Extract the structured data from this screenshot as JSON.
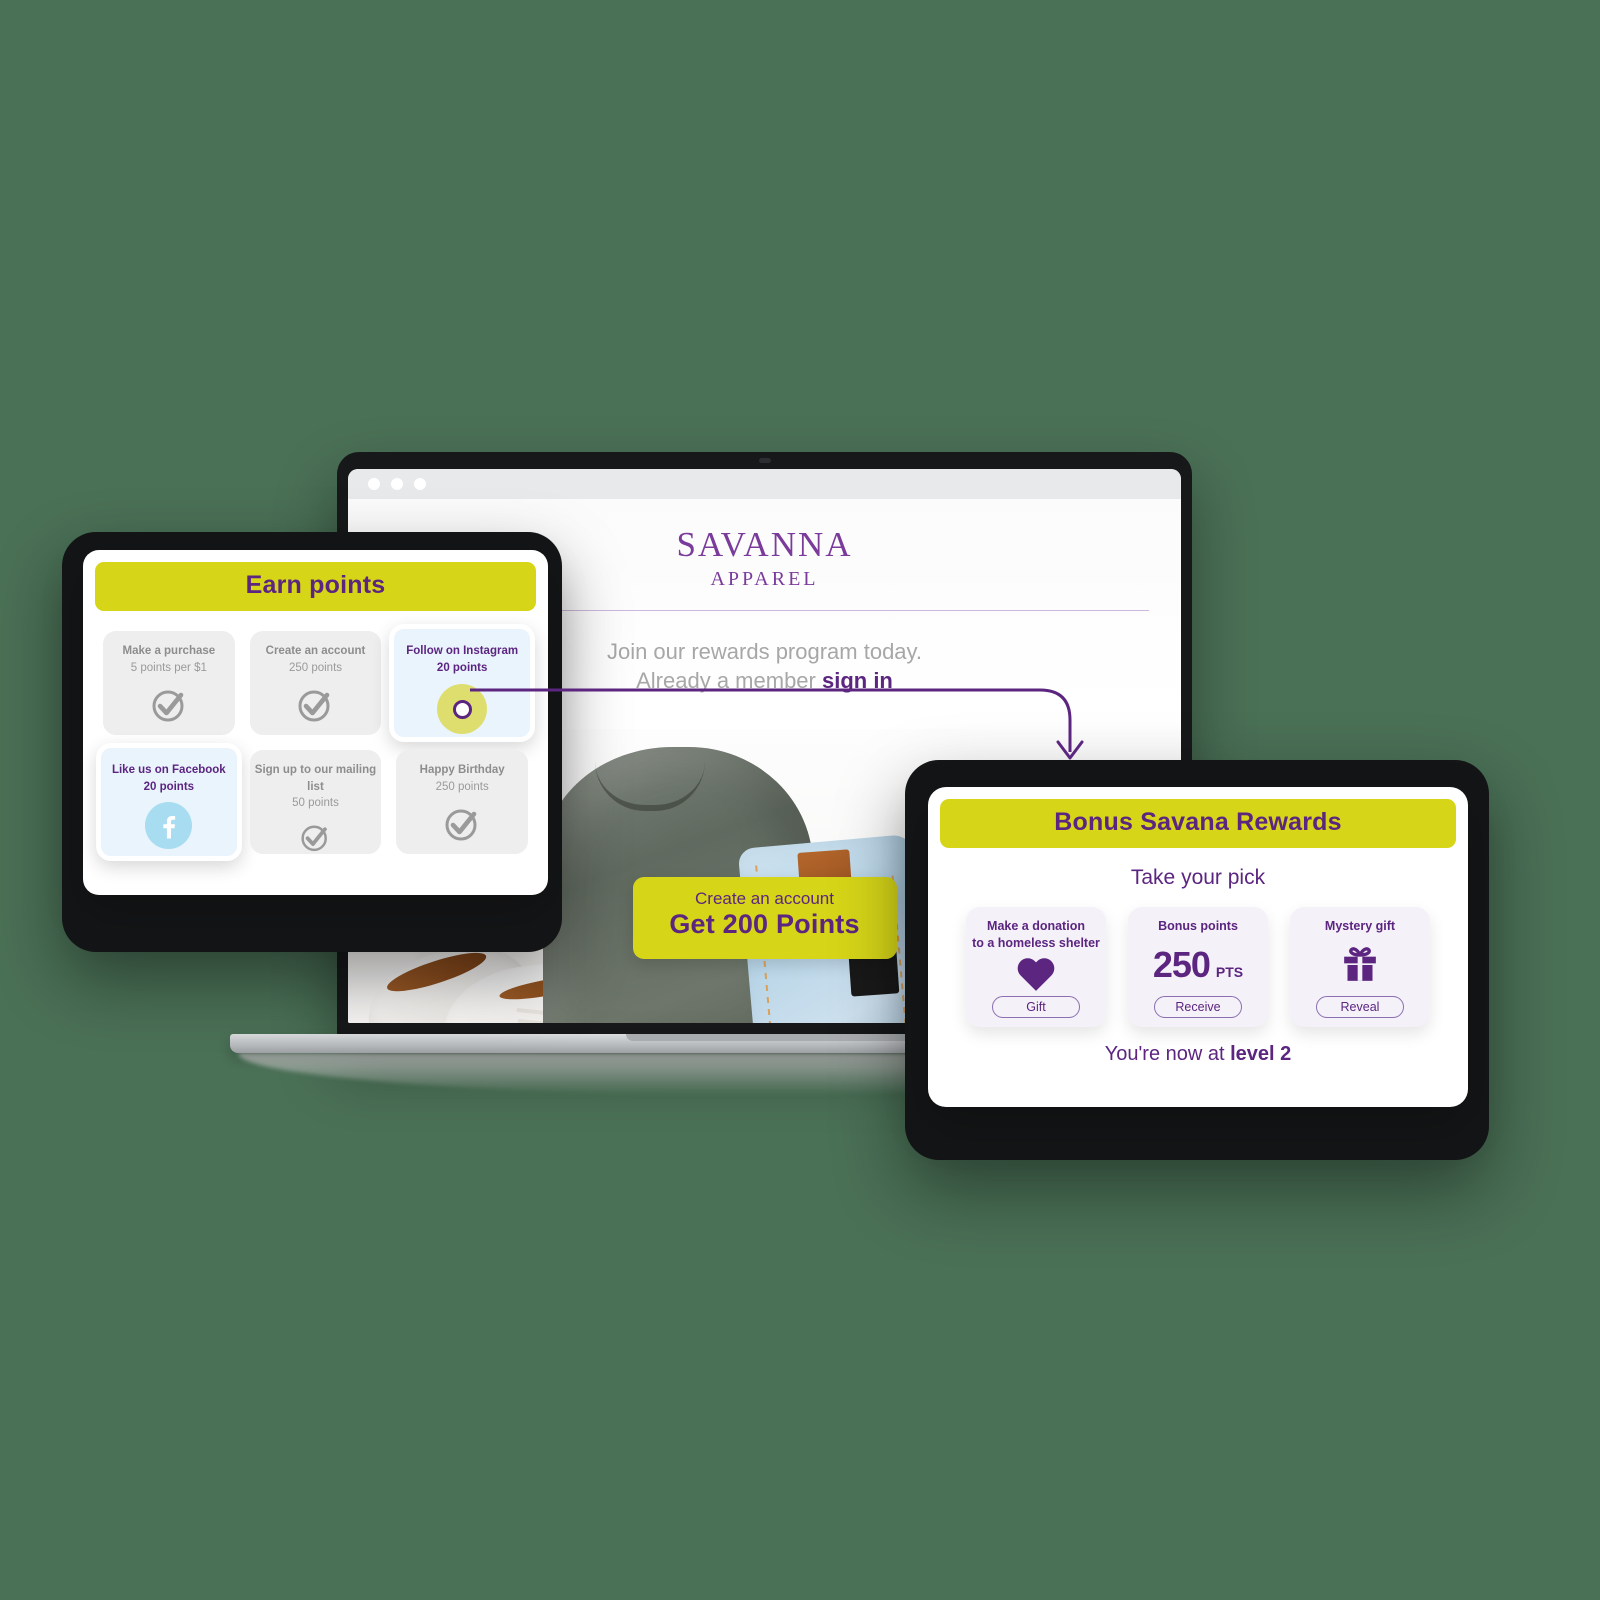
{
  "browser": {
    "dots": [
      "dot-1",
      "dot-2",
      "dot-3"
    ]
  },
  "site": {
    "brand_name": "SAVANNA",
    "brand_sub": "APPAREL",
    "tagline_line1": "Join our rewards program today.",
    "tagline_line2_prefix": "Already a member ",
    "tagline_signin": "sign in",
    "cta_top": "Create an account",
    "cta_main": "Get 200 Points"
  },
  "earn_panel": {
    "title": "Earn points",
    "tiles": [
      {
        "title": "Make a purchase",
        "points": "5 points per $1",
        "icon": "check-circle-icon",
        "state": "inactive"
      },
      {
        "title": "Create an account",
        "points": "250 points",
        "icon": "check-circle-icon",
        "state": "inactive"
      },
      {
        "title": "Follow on Instagram",
        "points": "20 points",
        "icon": "instagram-node-icon",
        "state": "active"
      },
      {
        "title": "Like us on Facebook",
        "points": "20 points",
        "icon": "facebook-icon",
        "state": "active"
      },
      {
        "title": "Sign up to our mailing list",
        "points": "50 points",
        "icon": "check-circle-icon",
        "state": "inactive"
      },
      {
        "title": "Happy Birthday",
        "points": "250 points",
        "icon": "check-circle-icon",
        "state": "inactive"
      }
    ]
  },
  "bonus_panel": {
    "title": "Bonus Savana Rewards",
    "subtitle": "Take your pick",
    "tiles": [
      {
        "title": "Make a donation\nto a homeless shelter",
        "title_line1": "Make a donation",
        "title_line2": "to a homeless shelter",
        "icon": "heart-icon",
        "value": "",
        "unit": "",
        "button": "Gift"
      },
      {
        "title_line1": "Bonus points",
        "title_line2": "",
        "icon": "points-value",
        "value": "250",
        "unit": "PTS",
        "button": "Receive"
      },
      {
        "title_line1": "Mystery gift",
        "title_line2": "",
        "icon": "gift-icon",
        "value": "",
        "unit": "",
        "button": "Reveal"
      }
    ],
    "footer_prefix": "You're now at ",
    "footer_level": "level 2"
  },
  "colors": {
    "accent_yellow": "#d6d518",
    "brand_purple": "#5b2580",
    "logo_purple": "#7a3b9b",
    "facebook_blue": "#a8dcf0",
    "node_yellow": "#dede6e",
    "tile_gray": "#eeeeee",
    "tile_active_blue": "#eaf4fd",
    "bonus_tile": "#f4f1f9",
    "background_green": "#4a7056"
  }
}
